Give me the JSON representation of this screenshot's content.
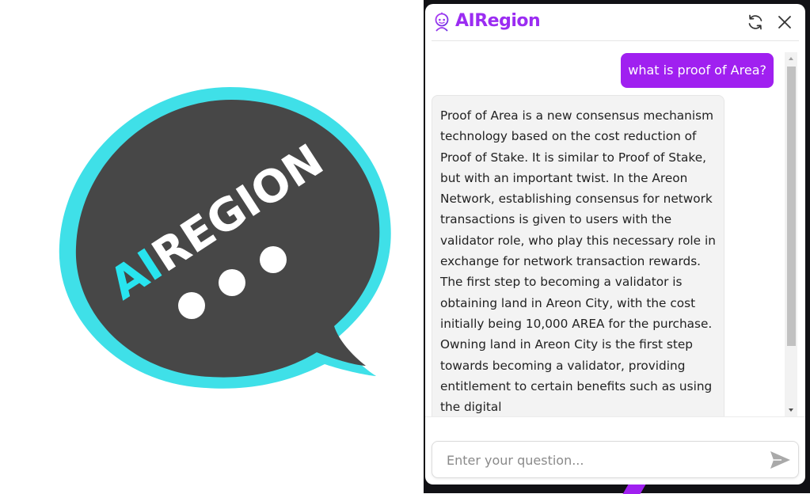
{
  "logo": {
    "text_accent": "AI",
    "text_main": "REGION",
    "colors": {
      "bubble": "#474747",
      "outline": "#3fe0e8",
      "accent_text": "#28e4ef",
      "main_text": "#ffffff"
    }
  },
  "widget": {
    "brand_name": "AIRegion",
    "brand_color": "#9b2cf2",
    "header_icons": [
      "refresh-icon",
      "close-icon"
    ]
  },
  "messages": {
    "user": "what is proof of Area?",
    "bot": "Proof of Area is a new consensus mechanism technology based on the cost reduction of Proof of Stake. It is similar to Proof of Stake, but with an important twist. In the Areon Network, establishing consensus for network transactions is given to users with the validator role, who play this necessary role in exchange for network transaction rewards. The first step to becoming a validator is obtaining land in Areon City, with the cost initially being 10,000 AREA for the purchase. Owning land in Areon City is the first step towards becoming a validator, providing entitlement to certain benefits such as using the digital",
    "user_bubble_color": "#a020f0"
  },
  "composer": {
    "placeholder": "Enter your question...",
    "send_icon": "send-icon"
  }
}
